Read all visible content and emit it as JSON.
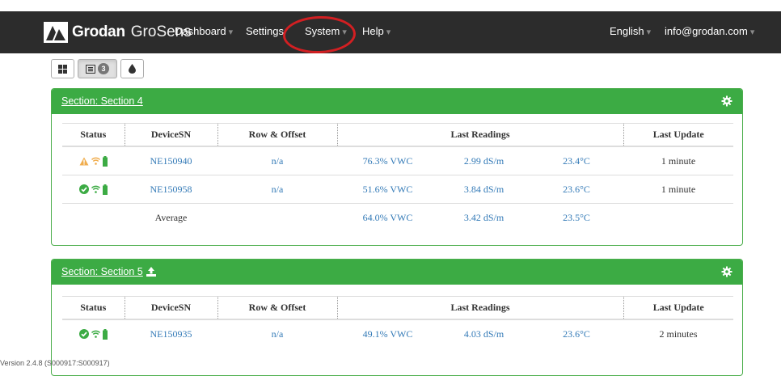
{
  "navbar": {
    "brand_name": "Grodan",
    "brand_product": "GroSens",
    "menu": [
      {
        "label": "Dashboard"
      },
      {
        "label": "Settings"
      },
      {
        "label": "System"
      },
      {
        "label": "Help"
      }
    ],
    "language": "English",
    "user": "info@grodan.com",
    "annotation_color": "#d21f22"
  },
  "toolbar": {
    "buttons": [
      {
        "icon": "grid-icon"
      },
      {
        "icon": "list-icon",
        "badge": "3"
      },
      {
        "icon": "water-drop-icon"
      }
    ]
  },
  "sections": [
    {
      "title": "Section: Section 4",
      "columns": [
        "Status",
        "DeviceSN",
        "Row & Offset",
        "Last Readings",
        "Last Update"
      ],
      "rows": [
        {
          "status": "warning",
          "device": "NE150940",
          "row_offset": "n/a",
          "vwc": "76.3% VWC",
          "ec": "2.99 dS/m",
          "temp": "23.4°C",
          "update": "1 minute"
        },
        {
          "status": "ok",
          "device": "NE150958",
          "row_offset": "n/a",
          "vwc": "51.6% VWC",
          "ec": "3.84 dS/m",
          "temp": "23.6°C",
          "update": "1 minute"
        }
      ],
      "average": {
        "label": "Average",
        "vwc": "64.0% VWC",
        "ec": "3.42 dS/m",
        "temp": "23.5°C"
      }
    },
    {
      "title": "Section: Section 5",
      "columns": [
        "Status",
        "DeviceSN",
        "Row & Offset",
        "Last Readings",
        "Last Update"
      ],
      "rows": [
        {
          "status": "ok",
          "device": "NE150935",
          "row_offset": "n/a",
          "vwc": "49.1% VWC",
          "ec": "4.03 dS/m",
          "temp": "23.6°C",
          "update": "2 minutes"
        }
      ]
    }
  ],
  "footer": {
    "version": "Version 2.4.8 (S000917:S000917)"
  },
  "colors": {
    "navbar": "#2c2c2c",
    "panel_header": "#3cab44",
    "link": "#337ab7",
    "warning": "#f0ad4e",
    "ok": "#3cab44"
  }
}
